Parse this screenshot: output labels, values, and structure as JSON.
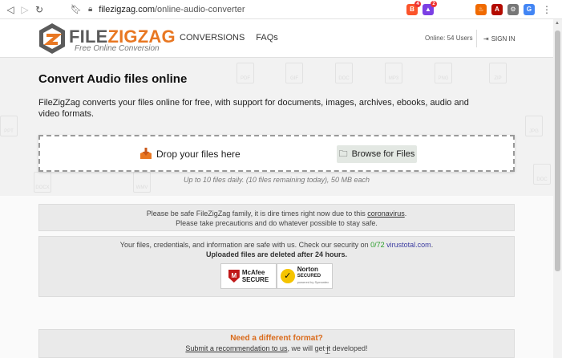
{
  "browser": {
    "url_host": "filezigzag.com",
    "url_path": "/online-audio-converter",
    "ext_badge_1": "4",
    "ext_badge_2": "2"
  },
  "header": {
    "logo_part1": "FILE",
    "logo_part2": "ZIGZAG",
    "tagline": "Free Online Conversion",
    "nav": [
      "CONVERSIONS",
      "FAQs"
    ],
    "online": "Online: 54 Users",
    "signin": "SIGN IN"
  },
  "main": {
    "title": "Convert Audio files online",
    "intro": "FileZigZag converts your files online for free, with support for documents, images, archives, ebooks, audio and video formats.",
    "drop_text": "Drop your files here",
    "browse_label": "Browse for Files",
    "limits": "Up to 10 files daily. (10 files remaining today), 50 MB each"
  },
  "ghost_labels": [
    "PDF",
    "GIF",
    "DOC",
    "MP3",
    "PNG",
    "ZIP",
    "PPT",
    "JPG",
    "DOCX",
    "WMV",
    "DOC"
  ],
  "notices": {
    "covid_line1_pre": "Please be safe FileZigZag family, it is dire times right now due to this ",
    "covid_link": "coronavirus",
    "covid_line1_post": ".",
    "covid_line2": "Please take precautions and do whatever possible to stay safe.",
    "security_pre": "Your files, credentials, and information are safe with us. Check our security on ",
    "vt_score": "0/72",
    "vt_link": "virustotal.com",
    "security_post": ".",
    "deleted": "Uploaded files are deleted after 24 hours.",
    "mcafee_l1": "McAfee",
    "mcafee_l2": "SECURE",
    "norton_l1": "Norton",
    "norton_l2": "SECURED",
    "norton_l3": "powered by Symantec"
  },
  "format": {
    "heading": "Need a different format?",
    "link": "Submit a recommendation to us",
    "rest": ", we will get it developed!"
  },
  "colors": {
    "brand_orange": "#e87722",
    "logo_grey": "#5b5b5b"
  }
}
